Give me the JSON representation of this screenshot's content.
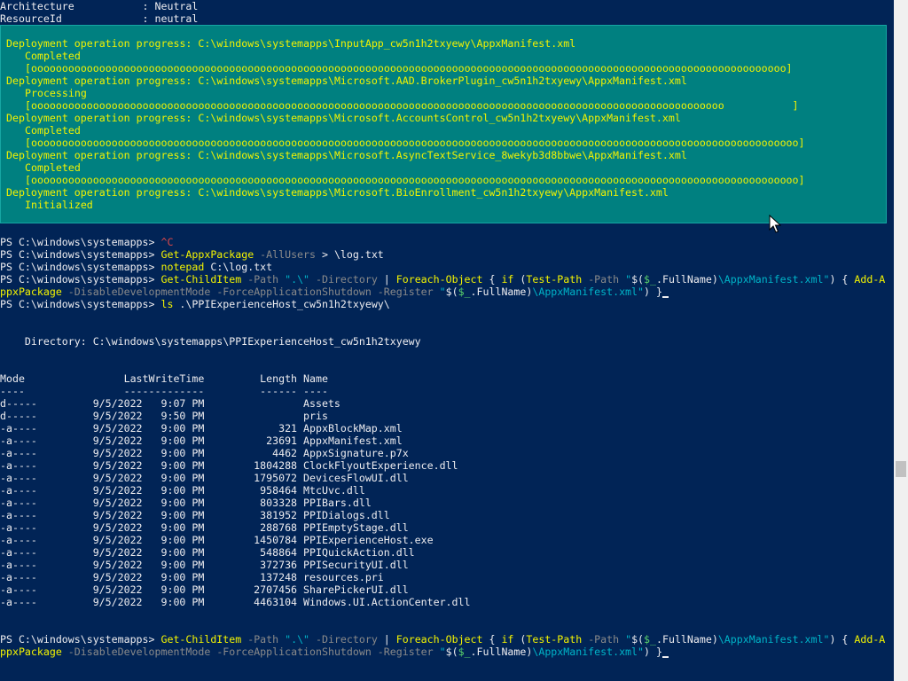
{
  "header": {
    "line1": "Architecture           : Neutral",
    "line2": "ResourceId             : neutral"
  },
  "progress": {
    "rows": [
      {
        "title": "Deployment operation progress: C:\\windows\\systemapps\\InputApp_cw5n1h2txyewy\\AppxManifest.xml",
        "status": "Completed",
        "bar": "[oooooooooooooooooooooooooooooooooooooooooooooooooooooooooooooooooooooooooooooooooooooooooooooooooooooooooooooooooooooooooo]"
      },
      {
        "title": "Deployment operation progress: C:\\windows\\systemapps\\Microsoft.AAD.BrokerPlugin_cw5n1h2txyewy\\AppxManifest.xml",
        "status": "Processing",
        "bar": "[oooooooooooooooooooooooooooooooooooooooooooooooooooooooooooooooooooooooooooooooooooooooooooooooooooooooooooooooo           ]"
      },
      {
        "title": "Deployment operation progress: C:\\windows\\systemapps\\Microsoft.AccountsControl_cw5n1h2txyewy\\AppxManifest.xml",
        "status": "Completed",
        "bar": "[oooooooooooooooooooooooooooooooooooooooooooooooooooooooooooooooooooooooooooooooooooooooooooooooooooooooooooooooooooooooooooo]"
      },
      {
        "title": "Deployment operation progress: C:\\windows\\systemapps\\Microsoft.AsyncTextService_8wekyb3d8bbwe\\AppxManifest.xml",
        "status": "Completed",
        "bar": "[oooooooooooooooooooooooooooooooooooooooooooooooooooooooooooooooooooooooooooooooooooooooooooooooooooooooooooooooooooooooooooo]"
      },
      {
        "title": "Deployment operation progress: C:\\windows\\systemapps\\Microsoft.BioEnrollment_cw5n1h2txyewy\\AppxManifest.xml",
        "status": "Initialized",
        "bar": ""
      }
    ]
  },
  "prompt": "PS C:\\windows\\systemapps> ",
  "commands": {
    "ctrl_c": "^C",
    "get_appx": {
      "cmd": "Get-AppxPackage",
      "param": " -AllUsers",
      "rest": " > \\log.txt"
    },
    "notepad": {
      "cmd": "notepad",
      "rest": " C:\\log.txt"
    },
    "ls": {
      "cmd": "ls",
      "rest": " .\\PPIExperienceHost_cw5n1h2txyewy\\"
    }
  },
  "register_cmd": {
    "t1": "Get-ChildItem",
    "t2": " -Path",
    "t3": " \".\\\"",
    "t4": " -Directory",
    "t5": " | ",
    "t6": "Foreach-Object",
    "t7": " { ",
    "t8": "if",
    "t9": " (",
    "t10": "Test-Path",
    "t11": " -Path",
    "t12": " \"",
    "t13": "$(",
    "t14": "$_",
    "t15": ".FullName)",
    "t16": "\\AppxManifest.xml\"",
    "t17": ") { ",
    "t18": "Add-A",
    "u1": "ppxPackage",
    "u2": " -DisableDevelopmentMode",
    "u3": " -ForceApplicationShutdown",
    "u4": " -Register",
    "u5": " \"",
    "u6": "$(",
    "u7": "$_",
    "u8": ".FullName)",
    "u9": "\\AppxManifest.xml\"",
    "u10": ") }"
  },
  "directory": {
    "label": "    Directory: C:\\windows\\systemapps\\PPIExperienceHost_cw5n1h2txyewy",
    "header": "Mode                LastWriteTime         Length Name",
    "divider": "----                -------------         ------ ----",
    "rows": [
      "d-----         9/5/2022   9:07 PM                Assets",
      "d-----         9/5/2022   9:50 PM                pris",
      "-a----         9/5/2022   9:00 PM            321 AppxBlockMap.xml",
      "-a----         9/5/2022   9:00 PM          23691 AppxManifest.xml",
      "-a----         9/5/2022   9:00 PM           4462 AppxSignature.p7x",
      "-a----         9/5/2022   9:00 PM        1804288 ClockFlyoutExperience.dll",
      "-a----         9/5/2022   9:00 PM        1795072 DevicesFlowUI.dll",
      "-a----         9/5/2022   9:00 PM         958464 MtcUvc.dll",
      "-a----         9/5/2022   9:00 PM         803328 PPIBars.dll",
      "-a----         9/5/2022   9:00 PM         381952 PPIDialogs.dll",
      "-a----         9/5/2022   9:00 PM         288768 PPIEmptyStage.dll",
      "-a----         9/5/2022   9:00 PM        1450784 PPIExperienceHost.exe",
      "-a----         9/5/2022   9:00 PM         548864 PPIQuickAction.dll",
      "-a----         9/5/2022   9:00 PM         372736 PPISecurityUI.dll",
      "-a----         9/5/2022   9:00 PM         137248 resources.pri",
      "-a----         9/5/2022   9:00 PM        2707456 SharePickerUI.dll",
      "-a----         9/5/2022   9:00 PM        4463104 Windows.UI.ActionCenter.dll"
    ]
  },
  "colors": {
    "background": "#012456",
    "progress_bg": "#008080",
    "progress_text": "#f2f200"
  }
}
